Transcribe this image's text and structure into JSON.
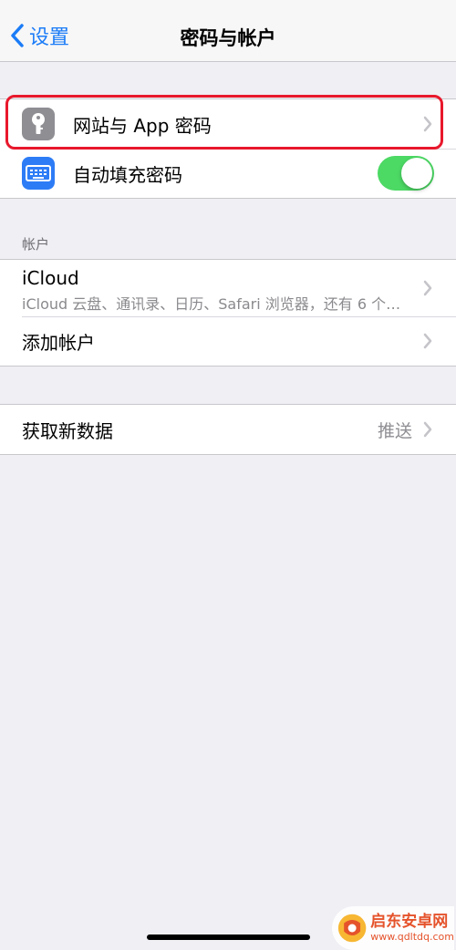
{
  "navbar": {
    "back_label": "设置",
    "title": "密码与帐户"
  },
  "passwords": {
    "website_app_passwords": "网站与 App 密码",
    "autofill_passwords": "自动填充密码",
    "autofill_enabled": true
  },
  "accounts": {
    "header": "帐户",
    "icloud_title": "iCloud",
    "icloud_subtitle": "iCloud 云盘、通讯录、日历、Safari 浏览器，还有 6 个…",
    "add_account": "添加帐户"
  },
  "fetch": {
    "label": "获取新数据",
    "value": "推送"
  },
  "watermark": {
    "name": "启东安卓网",
    "url": "www.qdltdq.com"
  },
  "colors": {
    "accent": "#1b7cf7",
    "toggle_on": "#4cd964",
    "highlight": "#e8182c"
  }
}
